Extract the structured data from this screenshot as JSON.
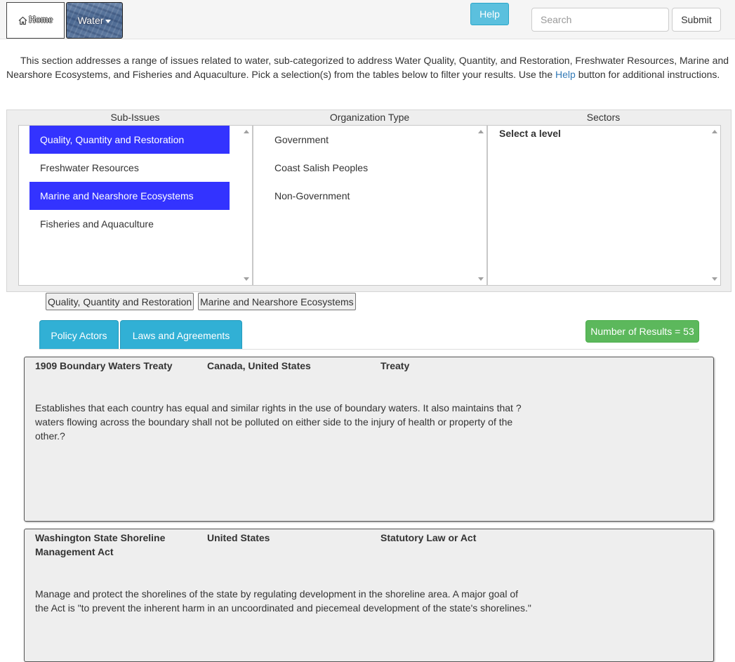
{
  "nav": {
    "home_label": "Home",
    "water_label": "Water",
    "help_label": "Help",
    "search_placeholder": "Search",
    "submit_label": "Submit"
  },
  "intro": {
    "text": "This section addresses a range of issues related to water, sub-categorized to address Water Quality, Quantity, and Restoration, Freshwater Resources, Marine and Nearshore Ecosystems, and Fisheries and Aquaculture. Pick a selection(s) from the tables below to filter your results. Use the ",
    "help_link": "Help",
    "text_after": " button for additional instructions."
  },
  "filters": {
    "sub_issues_header": "Sub-Issues",
    "organization_header": "Organization Type",
    "sectors_header": "Sectors",
    "sub_issues": [
      {
        "label": "Quality, Quantity and Restoration",
        "selected": true
      },
      {
        "label": "Freshwater Resources",
        "selected": false
      },
      {
        "label": "Marine and Nearshore Ecosystems",
        "selected": true
      },
      {
        "label": "Fisheries and Aquaculture",
        "selected": false
      }
    ],
    "organization_types": [
      {
        "label": "Government"
      },
      {
        "label": "Coast Salish Peoples"
      },
      {
        "label": "Non-Government"
      }
    ],
    "sectors_placeholder": "Select a level"
  },
  "selected_tags": [
    "Quality, Quantity and Restoration",
    "Marine and Nearshore Ecosystems"
  ],
  "tabs": {
    "policy_actors": "Policy Actors",
    "laws_agreements": "Laws and Agreements"
  },
  "results_badge": "Number of Results = 53",
  "results": [
    {
      "name": "1909 Boundary Waters Treaty",
      "countries": "Canada, United States",
      "type": "Treaty",
      "description": "Establishes that each country has equal and similar rights in the use of boundary waters. It also maintains that ?waters flowing across the boundary shall not be polluted on either side to the injury of health or property of the other.?"
    },
    {
      "name": "Washington State Shoreline Management Act",
      "countries": "United States",
      "type": "Statutory Law or Act",
      "description": "Manage and protect the shorelines of the state by regulating development in the shoreline area. A major goal of the Act is \"to prevent the inherent harm in an uncoordinated and piecemeal development of the state's shorelines.\""
    }
  ],
  "colors": {
    "selected_option": "#3333ff",
    "tab": "#31b0d5",
    "help_button": "#5bc0de",
    "results_badge": "#5cb85c"
  }
}
